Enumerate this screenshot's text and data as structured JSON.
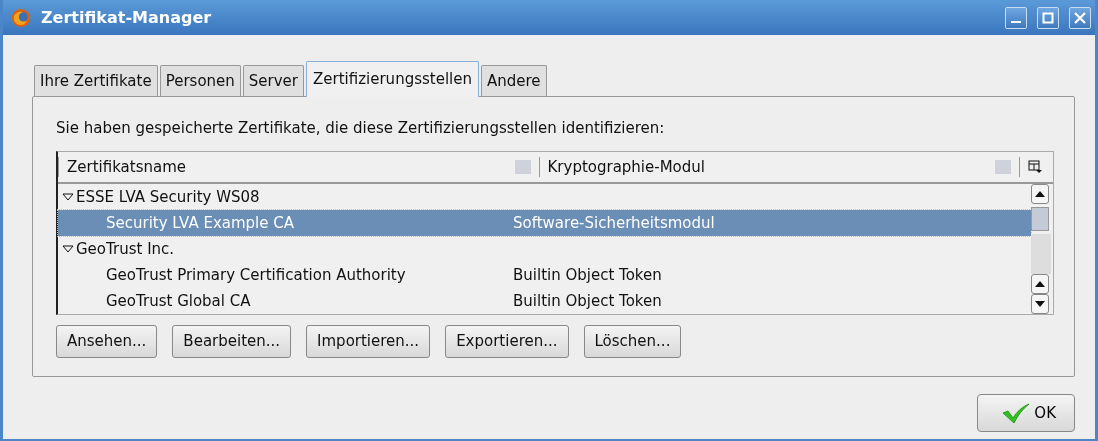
{
  "window": {
    "title": "Zertifikat-Manager"
  },
  "tabs": [
    {
      "label": "Ihre Zertifikate",
      "selected": false
    },
    {
      "label": "Personen",
      "selected": false
    },
    {
      "label": "Server",
      "selected": false
    },
    {
      "label": "Zertifizierungsstellen",
      "selected": true
    },
    {
      "label": "Andere",
      "selected": false
    }
  ],
  "description": "Sie haben gespeicherte Zertifikate, die diese Zertifizierungsstellen identifizieren:",
  "table": {
    "columns": [
      "Zertifikatsname",
      "Kryptographie-Modul"
    ],
    "rows": [
      {
        "name": "ESSE LVA Security WS08",
        "expanded": true,
        "children": [
          {
            "name": "Security LVA Example CA",
            "module": "Software-Sicherheitsmodul",
            "selected": true
          }
        ]
      },
      {
        "name": "GeoTrust Inc.",
        "expanded": true,
        "children": [
          {
            "name": "GeoTrust Primary Certification Authority",
            "module": "Builtin Object Token",
            "selected": false
          },
          {
            "name": "GeoTrust Global CA",
            "module": "Builtin Object Token",
            "selected": false
          }
        ]
      }
    ]
  },
  "buttons": [
    "Ansehen...",
    "Bearbeiten...",
    "Importieren...",
    "Exportieren...",
    "Löschen..."
  ],
  "ok_button": "OK"
}
